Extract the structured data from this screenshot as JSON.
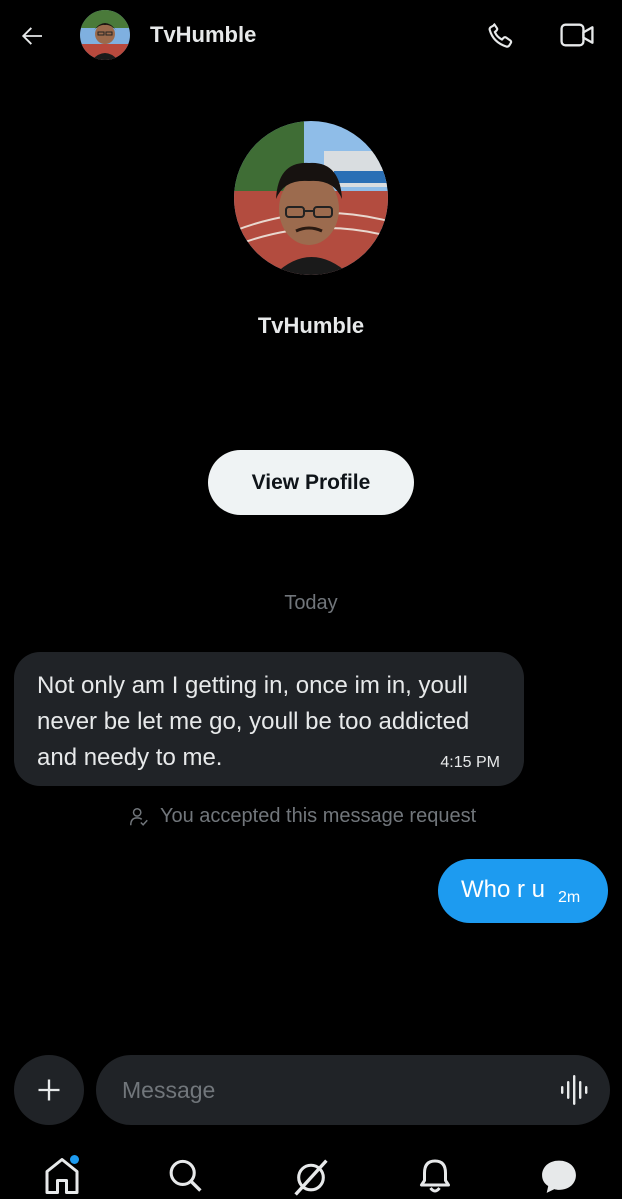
{
  "header": {
    "contact_name": "TvHumble",
    "icons": {
      "back": "arrow-left-icon",
      "call": "phone-icon",
      "video": "video-camera-icon"
    }
  },
  "profile": {
    "name": "TvHumble",
    "view_profile_label": "View Profile"
  },
  "conversation": {
    "date_separator": "Today",
    "messages": [
      {
        "direction": "incoming",
        "text": "Not only am I getting in, once im in, youll never be let me go, youll be too addicted and needy to me.",
        "time": "4:15 PM"
      },
      {
        "direction": "outgoing",
        "text": "Who r u",
        "time": "2m"
      }
    ],
    "request_note": "You accepted this message request"
  },
  "composer": {
    "placeholder": "Message",
    "icons": {
      "add": "plus-icon",
      "voice": "audio-waveform-icon"
    }
  },
  "bottom_nav": {
    "items": [
      "home-icon",
      "search-icon",
      "grok-icon",
      "notifications-bell-icon",
      "messages-icon"
    ],
    "home_has_notification_dot": true
  },
  "colors": {
    "accent": "#1d9bf0",
    "background": "#000000",
    "bubble_incoming": "#202327",
    "muted_text": "#71767b"
  }
}
